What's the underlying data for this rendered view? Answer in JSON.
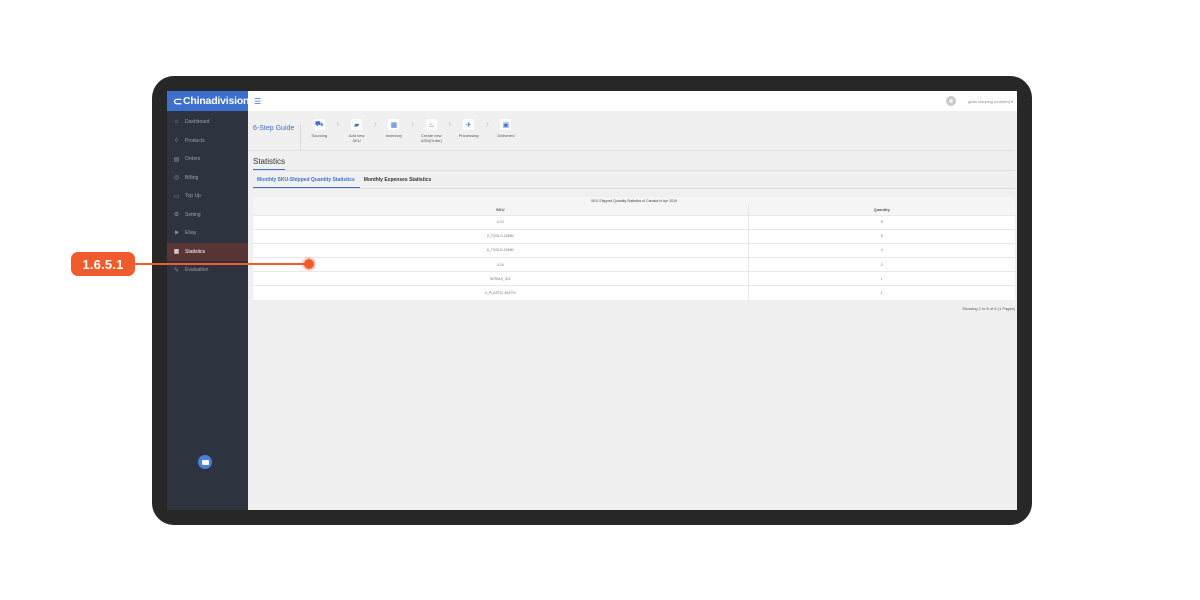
{
  "app": {
    "logo_text": "Chinadivision"
  },
  "sidebar": {
    "items": [
      {
        "label": "Dashboard",
        "icon": "home-icon",
        "glyph": "⌂"
      },
      {
        "label": "Products",
        "icon": "basket-icon",
        "glyph": "◊"
      },
      {
        "label": "Orders",
        "icon": "orders-icon",
        "glyph": "▤"
      },
      {
        "label": "Billing",
        "icon": "billing-icon",
        "glyph": "◎"
      },
      {
        "label": "Top Up",
        "icon": "card-icon",
        "glyph": "▭"
      },
      {
        "label": "Setting",
        "icon": "gear-icon",
        "glyph": "⚙"
      },
      {
        "label": "Ebay",
        "icon": "ebay-icon",
        "glyph": "⚑"
      },
      {
        "label": "Statistics",
        "icon": "statistics-icon",
        "glyph": "▦",
        "active": true
      },
      {
        "label": "Evaluation",
        "icon": "evaluation-icon",
        "glyph": "✎"
      }
    ]
  },
  "topbar": {
    "user_label": "guan chinping (cnetom) ▾"
  },
  "guide": {
    "title": "6-Step Guide",
    "steps": [
      {
        "label": "Sourcing",
        "icon": "cart-icon",
        "glyph": "⛟"
      },
      {
        "label": "Add new SKU",
        "icon": "truck-icon",
        "glyph": "▰"
      },
      {
        "label": "Inventory",
        "icon": "inventory-icon",
        "glyph": "▦"
      },
      {
        "label": "Create new ASN(Order)",
        "icon": "flask-icon",
        "glyph": "♨"
      },
      {
        "label": "Processing",
        "icon": "processing-icon",
        "glyph": "✈"
      },
      {
        "label": "Delivered",
        "icon": "box-icon",
        "glyph": "▣"
      }
    ]
  },
  "page": {
    "title": "Statistics"
  },
  "tabs": [
    {
      "label": "Monthly SKU-Shipped Quantity Statistics",
      "active": true
    },
    {
      "label": "Monthly Expenses Statistics",
      "active": false
    }
  ],
  "table": {
    "caption": "SKU-Shipped Quantity Statistics of Canada in Apr 2019",
    "columns": [
      "SKU",
      "Quantity"
    ],
    "rows": [
      [
        "0-10",
        "8"
      ],
      [
        "0_TOOLS-20MM",
        "5"
      ],
      [
        "6_TOOLS-20MM",
        "4"
      ],
      [
        "4-16",
        "2"
      ],
      [
        "SERIAS_301",
        "1"
      ],
      [
        "0_PLASTIC-MIXTH",
        "1"
      ]
    ]
  },
  "pagination": {
    "text": "Showing 1 to 6 of 6 (1 Pages)"
  },
  "annotation": {
    "label": "1.6.5.1",
    "color": "#f25c2c"
  },
  "colors": {
    "accent": "#3d6fd1",
    "sidebar": "#2e3340",
    "bezel": "#272727"
  }
}
